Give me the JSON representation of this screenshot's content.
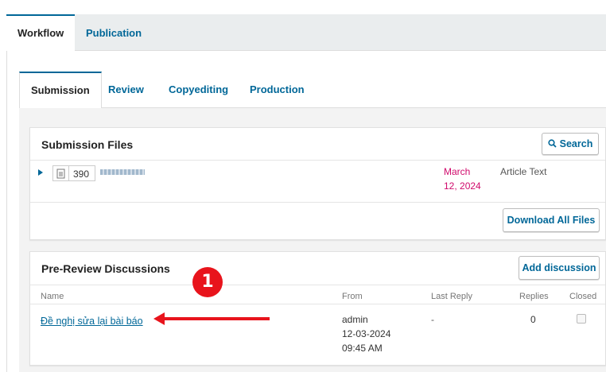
{
  "main_tabs": [
    {
      "label": "Workflow"
    },
    {
      "label": "Publication"
    }
  ],
  "sub_tabs": [
    {
      "label": "Submission"
    },
    {
      "label": "Review"
    },
    {
      "label": "Copyediting"
    },
    {
      "label": "Production"
    }
  ],
  "submission_files": {
    "title": "Submission Files",
    "search_label": "Search",
    "file": {
      "id": "390",
      "name": "",
      "date_line1": "March",
      "date_line2": "12, 2024",
      "type": "Article Text"
    },
    "download_all_label": "Download All Files"
  },
  "discussions": {
    "title": "Pre-Review Discussions",
    "add_label": "Add discussion",
    "columns": {
      "name": "Name",
      "from": "From",
      "last_reply": "Last Reply",
      "replies": "Replies",
      "closed": "Closed"
    },
    "rows": [
      {
        "name": "Đề nghị sửa lại bài báo",
        "from_user": "admin",
        "from_date": "12-03-2024",
        "from_time": "09:45 AM",
        "last_reply": "-",
        "replies": "0"
      }
    ]
  },
  "annotation": {
    "number": "1"
  },
  "colors": {
    "accent": "#006798",
    "annotation": "#e8141c",
    "date": "#d00a6c"
  }
}
